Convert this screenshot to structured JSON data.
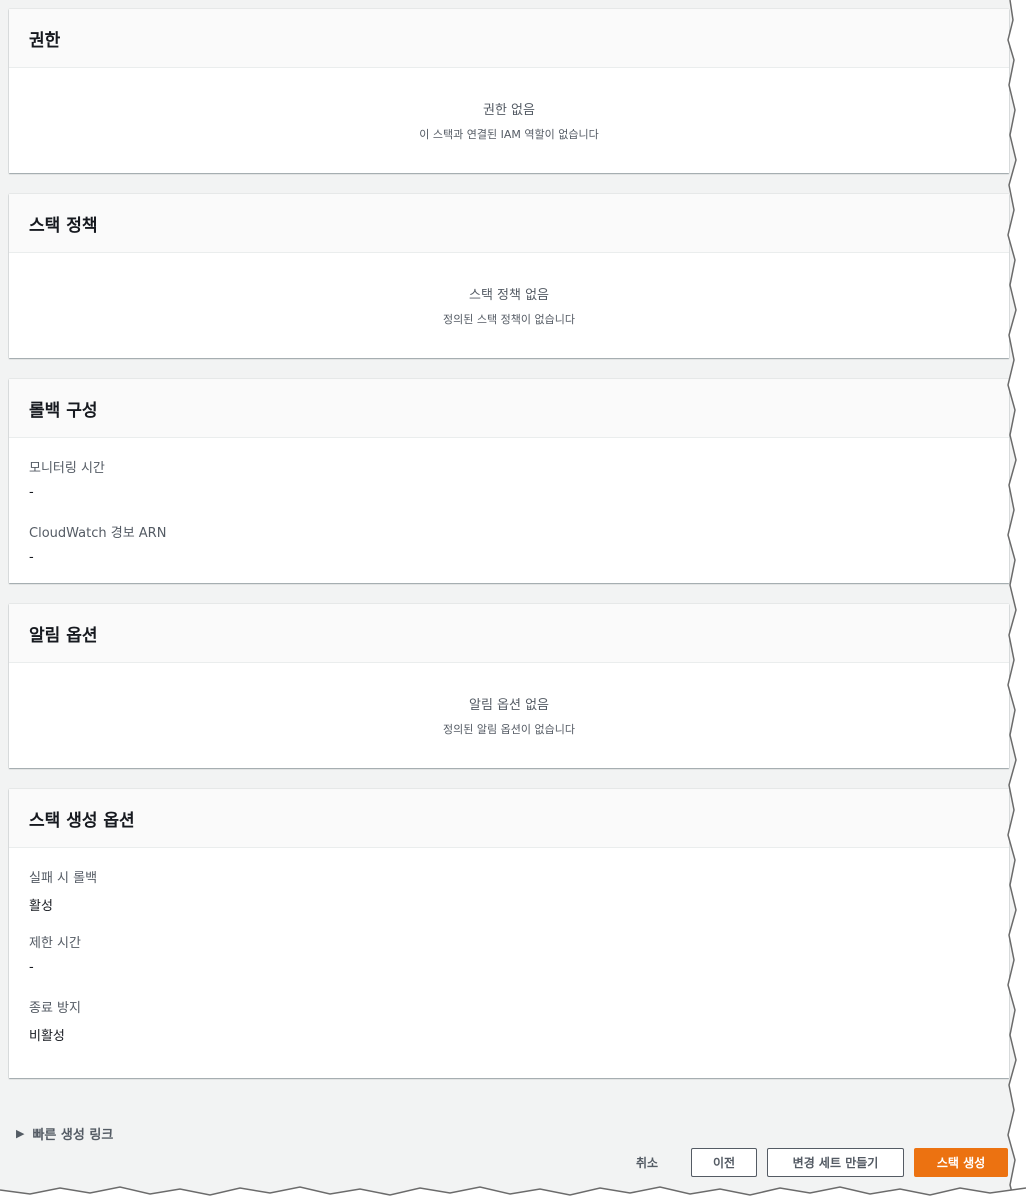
{
  "panels": {
    "permissions": {
      "title": "권한",
      "empty_title": "권한 없음",
      "empty_desc": "이 스택과 연결된 IAM 역할이 없습니다"
    },
    "stack_policy": {
      "title": "스택 정책",
      "empty_title": "스택 정책 없음",
      "empty_desc": "정의된 스택 정책이 없습니다"
    },
    "rollback": {
      "title": "롤백 구성",
      "fields": [
        {
          "label": "모니터링 시간",
          "value": "-"
        },
        {
          "label": "CloudWatch 경보 ARN",
          "value": "-"
        }
      ]
    },
    "notifications": {
      "title": "알림 옵션",
      "empty_title": "알림 옵션 없음",
      "empty_desc": "정의된 알림 옵션이 없습니다"
    },
    "creation_options": {
      "title": "스택 생성 옵션",
      "fields": [
        {
          "label": "실패 시 롤백",
          "value": "활성"
        },
        {
          "label": "제한 시간",
          "value": "-"
        },
        {
          "label": "종료 방지",
          "value": "비활성"
        }
      ]
    }
  },
  "quick_link": {
    "label": "빠른 생성 링크",
    "icon": "caret-right-icon"
  },
  "buttons": {
    "cancel": "취소",
    "previous": "이전",
    "create_change_set": "변경 세트 만들기",
    "create_stack": "스택 생성"
  },
  "colors": {
    "accent": "#ec7211",
    "background": "#f2f3f3",
    "header_bg": "#fafafa"
  }
}
